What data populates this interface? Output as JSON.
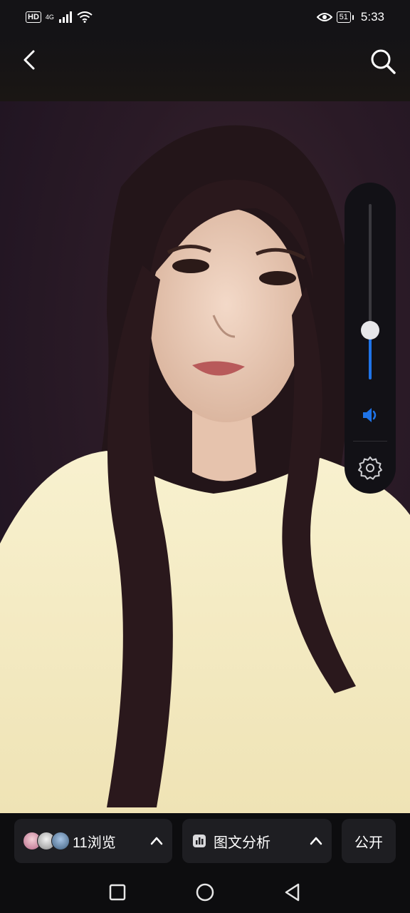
{
  "status_bar": {
    "left_badge": "HD",
    "network": "4G",
    "battery": "51",
    "time": "5:33",
    "icons": [
      "hd-badge",
      "signal-icon",
      "wifi-icon",
      "eye-icon",
      "battery-icon"
    ]
  },
  "top_nav": {
    "back_icon": "chevron-left-icon",
    "search_icon": "search-icon"
  },
  "volume_panel": {
    "level": 0.28,
    "accent": "#1f74e8",
    "speaker_icon": "speaker-icon",
    "settings_icon": "gear-icon"
  },
  "bottom_bar": {
    "views_label": "11浏览",
    "analysis_label": "图文分析",
    "public_label": "公开",
    "caret_icon": "chevron-up-icon",
    "analysis_icon": "bar-chart-icon"
  },
  "system_nav": {
    "icons": [
      "recent-apps-icon",
      "home-icon",
      "back-triangle-icon"
    ]
  }
}
